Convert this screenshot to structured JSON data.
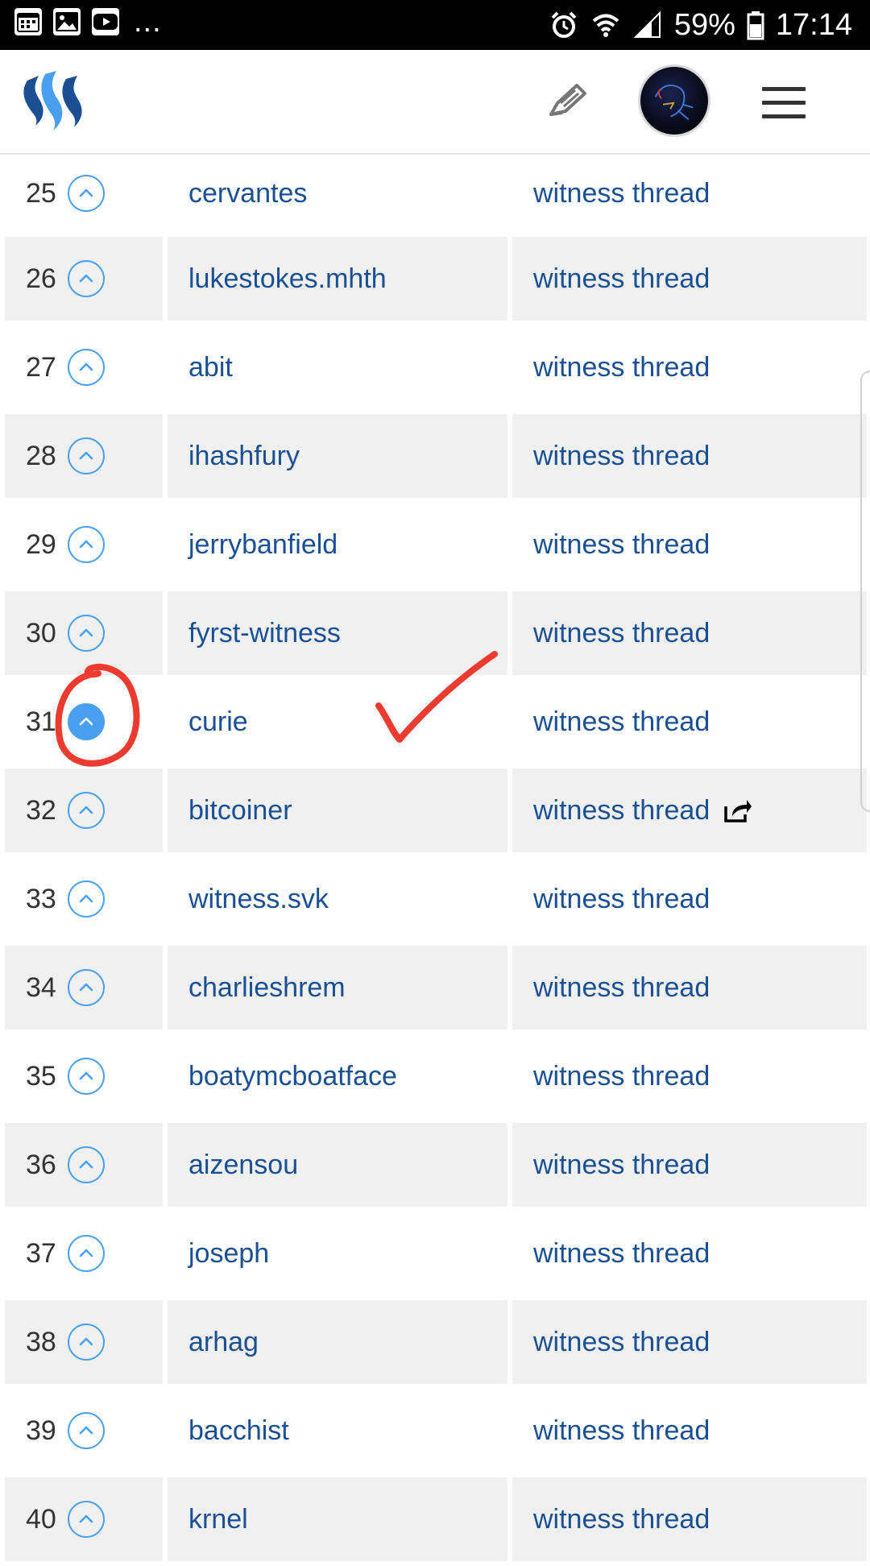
{
  "status_bar": {
    "icons_left": [
      "calendar-icon",
      "gallery-icon",
      "youtube-icon"
    ],
    "overflow": "...",
    "battery": "59%",
    "time": "17:14"
  },
  "header": {
    "logo": "steemit-logo",
    "edit_icon": "pencil-icon",
    "avatar": "user-avatar",
    "menu_icon": "hamburger-menu-icon"
  },
  "witness_table": {
    "rows": [
      {
        "rank": "25",
        "name": "cervantes",
        "link": "witness thread"
      },
      {
        "rank": "26",
        "name": "lukestokes.mhth",
        "link": "witness thread"
      },
      {
        "rank": "27",
        "name": "abit",
        "link": "witness thread"
      },
      {
        "rank": "28",
        "name": "ihashfury",
        "link": "witness thread"
      },
      {
        "rank": "29",
        "name": "jerrybanfield",
        "link": "witness thread"
      },
      {
        "rank": "30",
        "name": "fyrst-witness",
        "link": "witness thread"
      },
      {
        "rank": "31",
        "name": "curie",
        "link": "witness thread"
      },
      {
        "rank": "32",
        "name": "bitcoiner",
        "link": "witness thread"
      },
      {
        "rank": "33",
        "name": "witness.svk",
        "link": "witness thread"
      },
      {
        "rank": "34",
        "name": "charlieshrem",
        "link": "witness thread"
      },
      {
        "rank": "35",
        "name": "boatymcboatface",
        "link": "witness thread"
      },
      {
        "rank": "36",
        "name": "aizensou",
        "link": "witness thread"
      },
      {
        "rank": "37",
        "name": "joseph",
        "link": "witness thread"
      },
      {
        "rank": "38",
        "name": "arhag",
        "link": "witness thread"
      },
      {
        "rank": "39",
        "name": "bacchist",
        "link": "witness thread"
      },
      {
        "rank": "40",
        "name": "krnel",
        "link": "witness thread"
      }
    ]
  },
  "colors": {
    "link": "#1a4f93",
    "vote_accent": "#4aa0f0",
    "row_shade": "#f0f0f0",
    "annotation": "#ee3b2f"
  }
}
